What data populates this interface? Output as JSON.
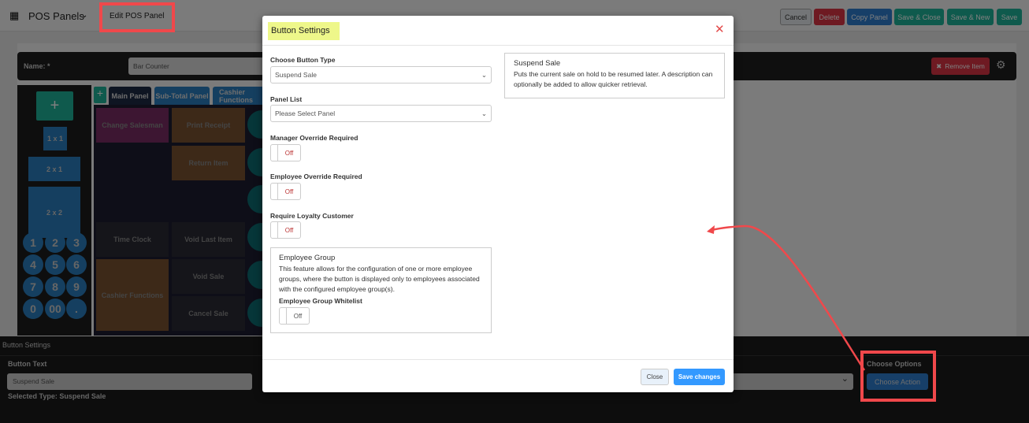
{
  "header": {
    "title": "POS Panels",
    "breadcrumb": "Edit POS Panel",
    "buttons": {
      "cancel": "Cancel",
      "delete": "Delete",
      "copy": "Copy Panel",
      "save_close": "Save & Close",
      "save_new": "Save & New",
      "save": "Save"
    }
  },
  "name_bar": {
    "label": "Name: *",
    "value": "Bar Counter",
    "remove": "Remove Item"
  },
  "palette": {
    "sizes": [
      "1 x 1",
      "2 x 1",
      "2 x 2"
    ],
    "keys": [
      "1",
      "2",
      "3",
      "4",
      "5",
      "6",
      "7",
      "8",
      "9",
      "0",
      "00",
      "."
    ]
  },
  "tabs": [
    "Main Panel",
    "Sub-Total Panel",
    "Cashier Functions"
  ],
  "grid_buttons": [
    "Change Salesman",
    "Print Receipt",
    "Return Item",
    "Time Clock",
    "Void Last Item",
    "Cashier Functions",
    "Void Sale",
    "Cancel Sale"
  ],
  "bottom": {
    "title": "Button Settings",
    "button_text_label": "Button Text",
    "button_text_value": "Suspend Sale",
    "selected_type": "Selected Type: Suspend Sale",
    "choose_options": "Choose Options",
    "choose_action": "Choose Action"
  },
  "modal": {
    "title": "Button Settings",
    "type_label": "Choose Button Type",
    "type_value": "Suspend Sale",
    "panel_label": "Panel List",
    "panel_placeholder": "Please Select Panel",
    "manager_label": "Manager Override Required",
    "employee_label": "Employee Override Required",
    "loyalty_label": "Require Loyalty Customer",
    "off": "Off",
    "group_title": "Employee Group",
    "group_desc": "This feature allows for the configuration of one or more employee groups, where the button is displayed only to employees associated with the configured employee group(s).",
    "whitelist_label": "Employee Group Whitelist",
    "info_title": "Suspend Sale",
    "info_desc": "Puts the current sale on hold to be resumed later. A description can optionally be added to allow quicker retrieval.",
    "close": "Close",
    "save": "Save changes"
  },
  "colors": {
    "annotation": "#f0484b",
    "highlight": "#eef78a",
    "primary": "#3399ff"
  }
}
